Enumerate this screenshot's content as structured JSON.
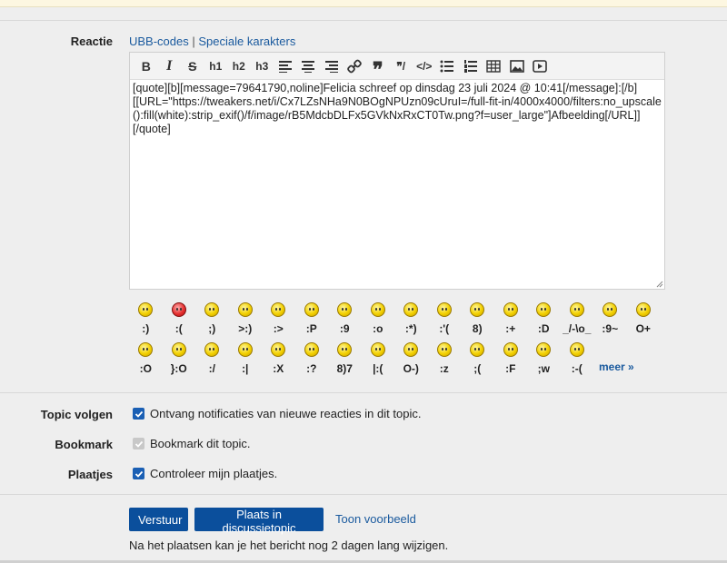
{
  "reactie": {
    "label": "Reactie",
    "ubb_codes": "UBB-codes",
    "separator": "|",
    "speciale_karakters": "Speciale karakters"
  },
  "toolbar": {
    "buttons": [
      "B",
      "I",
      "S",
      "h1",
      "h2",
      "h3",
      "align-left-icon",
      "align-center-icon",
      "align-right-icon",
      "link-icon",
      "quote-icon",
      "spoiler-icon",
      "code-icon",
      "bullet-list-icon",
      "numbered-list-icon",
      "table-icon",
      "image-icon",
      "video-icon"
    ],
    "bold": "B",
    "italic": "I",
    "strike": "S",
    "h1": "h1",
    "h2": "h2",
    "h3": "h3"
  },
  "editor": {
    "text": "[quote][b][message=79641790,noline]Felicia schreef op dinsdag 23 juli 2024 @ 10:41[/message]:[/b]\n[[URL=\"https://tweakers.net/i/Cx7LZsNHa9N0BOgNPUzn09cUruI=/full-fit-in/4000x4000/filters:no_upscale():fill(white):strip_exif()/f/image/rB5MdcbDLFx5GVkNxRxCT0Tw.png?f=user_large\"]Afbeelding[/URL]]\n[/quote]"
  },
  "smileys": {
    "row1": [
      ":)",
      ":(",
      ";)",
      ">:)",
      ":>",
      ":P",
      ":9",
      ":o",
      ":*)",
      ":'(",
      "8)",
      ":+",
      ":D",
      "_/-\\o_",
      ":9~",
      "O+"
    ],
    "row2": [
      ":O",
      "}:O",
      ":/",
      ":|",
      ":X",
      ":?",
      "8)7",
      "|:(",
      "O-)",
      ":z",
      ";(",
      ":F",
      ";w",
      ":-("
    ],
    "meer": "meer »"
  },
  "options": {
    "topic_volgen_label": "Topic volgen",
    "topic_volgen_text": "Ontvang notificaties van nieuwe reacties in dit topic.",
    "bookmark_label": "Bookmark",
    "bookmark_text": "Bookmark dit topic.",
    "plaatjes_label": "Plaatjes",
    "plaatjes_text": "Controleer mijn plaatjes."
  },
  "actions": {
    "verstuur": "Verstuur",
    "plaats": "Plaats in discussietopic",
    "voorbeeld": "Toon voorbeeld",
    "note": "Na het plaatsen kan je het bericht nog 2 dagen lang wijzigen."
  },
  "colors": {
    "accent": "#0b4f9c",
    "link": "#1a5a9e",
    "checkbox": "#1a5fb4"
  }
}
